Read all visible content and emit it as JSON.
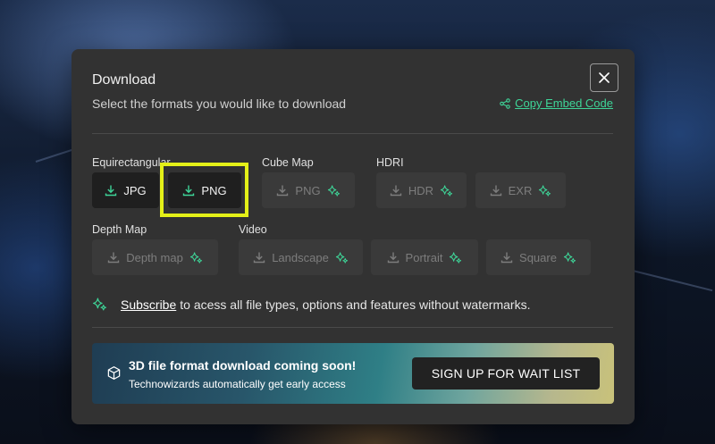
{
  "modal": {
    "title": "Download",
    "subtitle": "Select the formats you would like to download",
    "embed_link": "Copy Embed Code"
  },
  "groups": {
    "equirectangular": {
      "label": "Equirectangular",
      "buttons": [
        {
          "label": "JPG",
          "enabled": true
        },
        {
          "label": "PNG",
          "enabled": true,
          "highlighted": true
        }
      ]
    },
    "cube_map": {
      "label": "Cube Map",
      "buttons": [
        {
          "label": "PNG",
          "enabled": false,
          "premium": true
        }
      ]
    },
    "hdri": {
      "label": "HDRI",
      "buttons": [
        {
          "label": "HDR",
          "enabled": false,
          "premium": true
        },
        {
          "label": "EXR",
          "enabled": false,
          "premium": true
        }
      ]
    },
    "depth_map": {
      "label": "Depth Map",
      "buttons": [
        {
          "label": "Depth map",
          "enabled": false,
          "premium": true
        }
      ]
    },
    "video": {
      "label": "Video",
      "buttons": [
        {
          "label": "Landscape",
          "enabled": false,
          "premium": true
        },
        {
          "label": "Portrait",
          "enabled": false,
          "premium": true
        },
        {
          "label": "Square",
          "enabled": false,
          "premium": true
        }
      ]
    }
  },
  "subscribe": {
    "link": "Subscribe",
    "text": "to acess all file types, options and features without watermarks."
  },
  "banner": {
    "title": "3D file format download coming soon!",
    "subtitle": "Technowizards automatically get early access",
    "button": "SIGN UP FOR WAIT LIST"
  },
  "colors": {
    "accent": "#3ed598",
    "modal_bg": "#323232",
    "highlight": "#e4f018"
  },
  "icons": [
    "close-icon",
    "share-icon",
    "download-icon",
    "sparkle-icon",
    "cube-icon"
  ]
}
